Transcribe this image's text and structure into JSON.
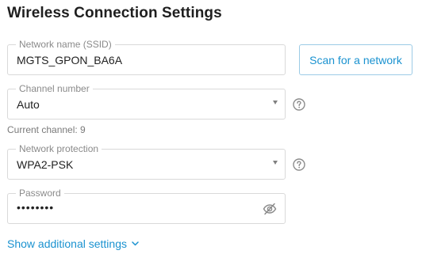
{
  "page": {
    "title": "Wireless Connection Settings"
  },
  "ssid": {
    "label": "Network name (SSID)",
    "value": "MGTS_GPON_BA6A"
  },
  "scan_button": {
    "label": "Scan for a network"
  },
  "channel": {
    "label": "Channel number",
    "value": "Auto",
    "hint": "Current channel: 9"
  },
  "protection": {
    "label": "Network protection",
    "value": "WPA2-PSK"
  },
  "password": {
    "label": "Password",
    "value": "••••••••",
    "visibility_icon": "eye-off-icon"
  },
  "additional": {
    "label": "Show additional settings",
    "icon": "chevron-down-icon"
  },
  "colors": {
    "accent": "#1a92d0",
    "border": "#d9d9d9",
    "label": "#8a8a8a"
  }
}
